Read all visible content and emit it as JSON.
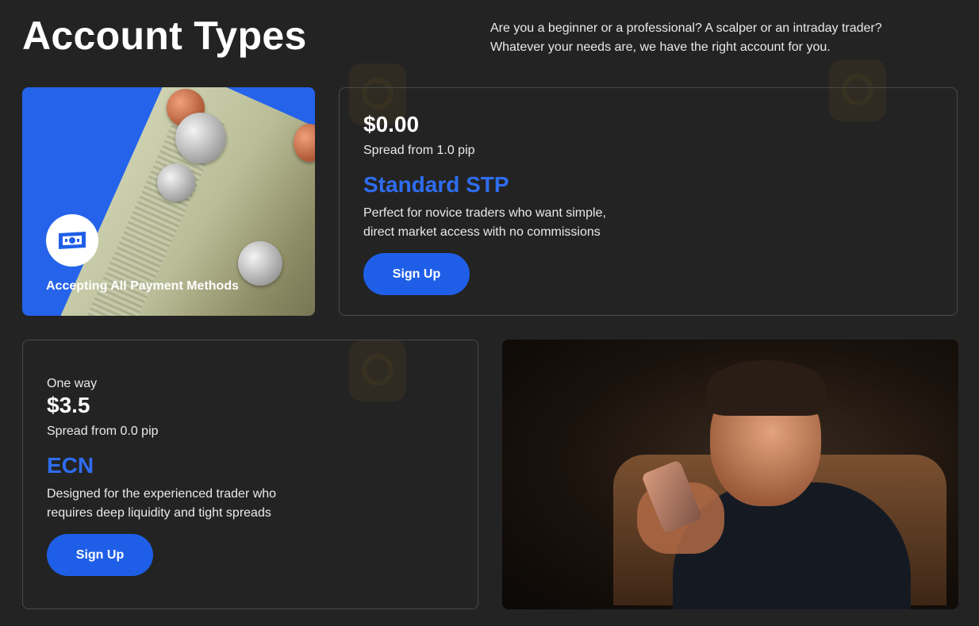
{
  "header": {
    "title": "Account Types",
    "intro_line1": "Are you a beginner or a professional? A scalper or an intraday trader?",
    "intro_line2": "Whatever your needs are, we have the right account for you."
  },
  "promo": {
    "label": "Accepting All Payment Methods",
    "icon": "banknote-icon"
  },
  "standard": {
    "price": "$0.00",
    "spread": "Spread from 1.0 pip",
    "name": "Standard STP",
    "desc_line1": "Perfect for novice traders who want simple,",
    "desc_line2": "direct market access with no commissions",
    "button": "Sign Up"
  },
  "ecn": {
    "pre_label": "One way",
    "price": "$3.5",
    "spread": "Spread from 0.0 pip",
    "name": "ECN",
    "desc_line1": "Designed for the experienced trader who",
    "desc_line2": "requires deep liquidity and tight spreads",
    "button": "Sign Up"
  },
  "colors": {
    "background": "#232323",
    "accent": "#2f6df0",
    "button": "#1f5fe8",
    "promo_bg": "#2563eb"
  }
}
